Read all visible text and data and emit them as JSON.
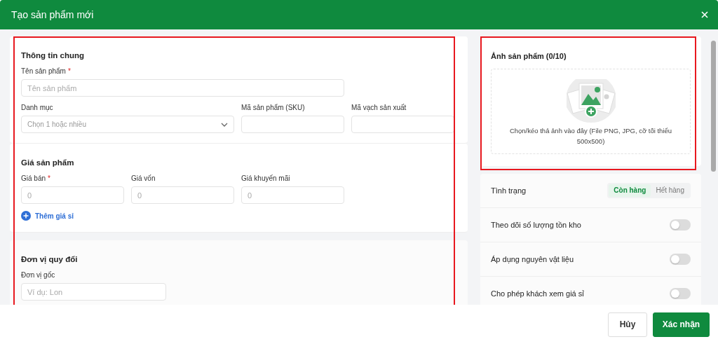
{
  "dialog": {
    "title": "Tạo sản phẩm mới"
  },
  "left_column": {
    "highlighted": true,
    "sections": [
      {
        "title": "Thông tin chung",
        "fields": [
          {
            "label": "Tên sản phẩm",
            "required_mark": "*",
            "kind": "text",
            "placeholder": "Tên sản phẩm"
          },
          {
            "label": "Danh mục",
            "kind": "select",
            "placeholder": "Chọn 1 hoặc nhiều"
          },
          {
            "label": "Mã sản phẩm (SKU)",
            "kind": "text"
          },
          {
            "label": "Mã vạch sản xuất",
            "kind": "text"
          }
        ]
      },
      {
        "title": "Giá sản phẩm",
        "fields": [
          {
            "label": "Giá bán",
            "required_mark": "*",
            "kind": "text",
            "placeholder": "0"
          },
          {
            "label": "Giá vốn",
            "kind": "text",
            "placeholder": "0"
          },
          {
            "label": "Giá khuyến mãi",
            "kind": "text",
            "placeholder": "0"
          }
        ],
        "add_link": "Thêm giá sỉ"
      },
      {
        "title": "Đơn vị quy đổi",
        "fields": [
          {
            "label": "Đơn vị gốc",
            "kind": "text",
            "placeholder": "Ví dụ: Lon"
          }
        ]
      }
    ]
  },
  "right_panel": {
    "image_card": {
      "highlighted": true,
      "title": "Ảnh sản phẩm (0/10)",
      "hint": "Chọn/kéo thả ảnh vào đây (File PNG, JPG, cỡ tối thiểu 500x500)"
    },
    "status": {
      "label": "Tình trạng",
      "options": [
        {
          "label": "Còn hàng",
          "selected": true
        },
        {
          "label": "Hết hàng",
          "selected": false
        }
      ]
    },
    "toggles": [
      {
        "label": "Theo dõi số lượng tồn kho",
        "on": false
      },
      {
        "label": "Áp dụng nguyên vật liệu",
        "on": false
      },
      {
        "label": "Cho phép khách xem giá sỉ",
        "on": false
      }
    ]
  },
  "footer": {
    "buttons": [
      {
        "label": "Hủy",
        "kind": "secondary"
      },
      {
        "label": "Xác nhận",
        "kind": "primary"
      }
    ]
  }
}
